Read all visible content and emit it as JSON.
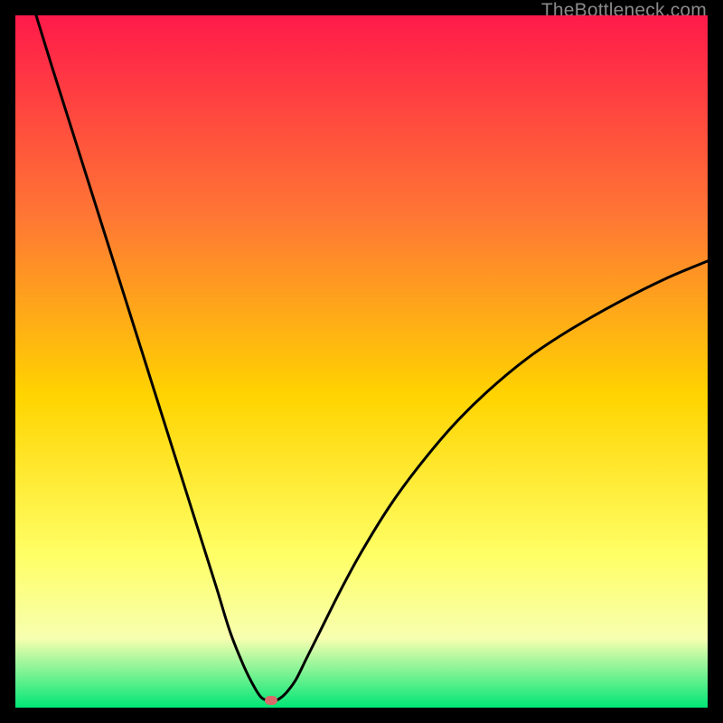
{
  "watermark": "TheBottleneck.com",
  "colors": {
    "gradient_top": "#ff1a4a",
    "gradient_mid1": "#ff7a33",
    "gradient_mid2": "#ffd400",
    "gradient_mid3": "#ffff66",
    "gradient_mid4": "#f7ffb0",
    "gradient_bottom": "#00e676",
    "curve": "#000000",
    "marker": "#d86a6a",
    "background": "#000000"
  },
  "chart_data": {
    "type": "line",
    "title": "",
    "xlabel": "",
    "ylabel": "",
    "xlim": [
      0,
      100
    ],
    "ylim": [
      0,
      100
    ],
    "grid": false,
    "legend": false,
    "series": [
      {
        "name": "bottleneck-curve",
        "x": [
          3,
          5,
          8,
          11,
          14,
          17,
          20,
          23,
          26,
          29,
          31,
          33,
          34.5,
          35.5,
          36.5,
          37.3,
          38,
          39,
          40.5,
          42,
          44,
          47,
          50,
          54,
          58,
          63,
          68,
          74,
          80,
          87,
          94,
          100
        ],
        "y": [
          100,
          93.5,
          84,
          74.5,
          65,
          55.5,
          46,
          36.5,
          27,
          17.5,
          11,
          6,
          3,
          1.5,
          1,
          1,
          1.2,
          2,
          4,
          7,
          11,
          17,
          22.5,
          29,
          34.5,
          40.5,
          45.5,
          50.5,
          54.5,
          58.5,
          62,
          64.5
        ]
      }
    ],
    "annotations": [
      {
        "name": "min-marker",
        "x": 37,
        "y": 1
      }
    ],
    "background_gradient": {
      "direction": "vertical",
      "stops": [
        {
          "pos": 0.0,
          "color": "#ff1a4a"
        },
        {
          "pos": 0.3,
          "color": "#ff7a33"
        },
        {
          "pos": 0.55,
          "color": "#ffd400"
        },
        {
          "pos": 0.78,
          "color": "#ffff66"
        },
        {
          "pos": 0.9,
          "color": "#f7ffb0"
        },
        {
          "pos": 1.0,
          "color": "#00e676"
        }
      ]
    }
  }
}
